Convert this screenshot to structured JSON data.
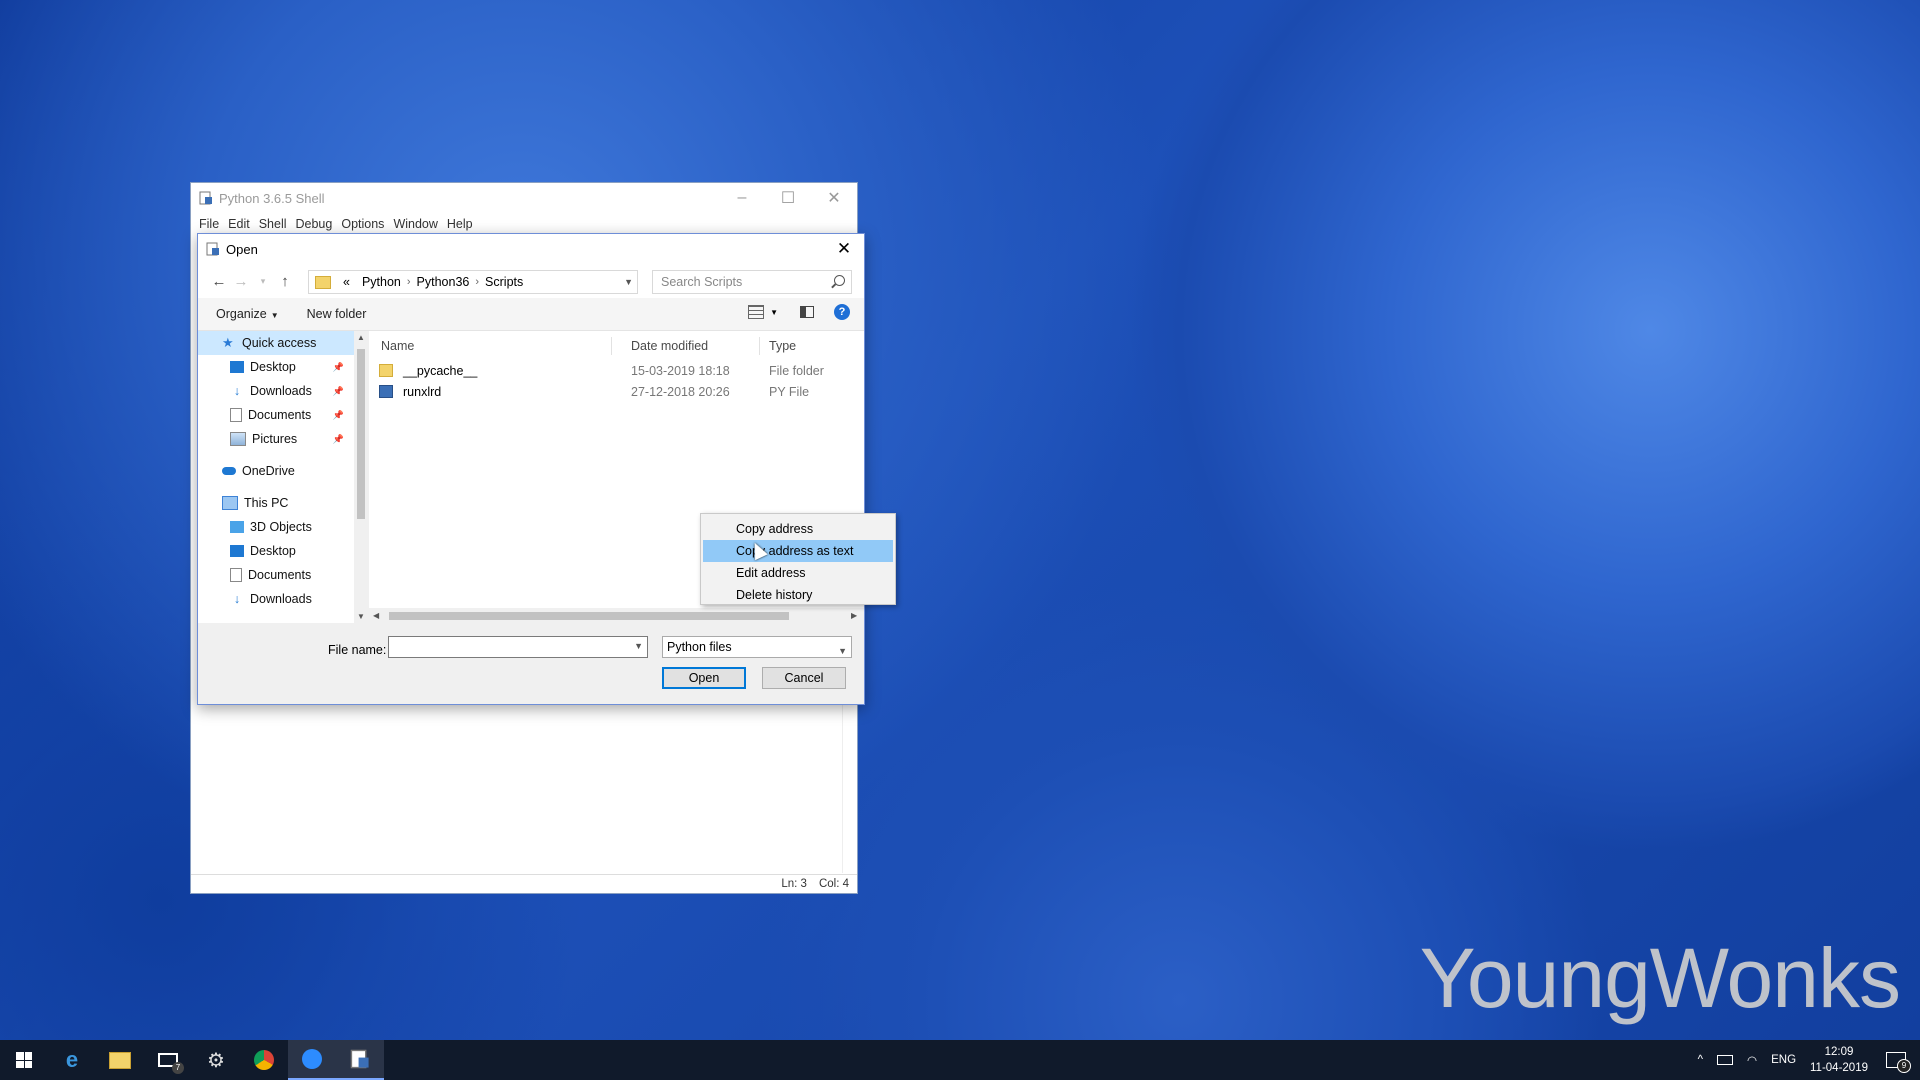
{
  "shell": {
    "title": "Python 3.6.5 Shell",
    "menu": [
      "File",
      "Edit",
      "Shell",
      "Debug",
      "Options",
      "Window",
      "Help"
    ],
    "status_ln": "Ln: 3",
    "status_col": "Col: 4"
  },
  "dialog": {
    "title": "Open",
    "breadcrumb": [
      "«",
      "Python",
      "Python36",
      "Scripts"
    ],
    "search_placeholder": "Search Scripts",
    "toolbar": {
      "organize": "Organize",
      "new_folder": "New folder"
    },
    "nav": [
      {
        "label": "Quick access",
        "icon": "star-icon"
      },
      {
        "label": "Desktop",
        "icon": "desktop-icon",
        "pinned": true
      },
      {
        "label": "Downloads",
        "icon": "download-icon",
        "pinned": true
      },
      {
        "label": "Documents",
        "icon": "document-icon",
        "pinned": true
      },
      {
        "label": "Pictures",
        "icon": "picture-icon",
        "pinned": true
      },
      {
        "label": "OneDrive",
        "icon": "cloud-icon"
      },
      {
        "label": "This PC",
        "icon": "computer-icon"
      },
      {
        "label": "3D Objects",
        "icon": "cube-icon"
      },
      {
        "label": "Desktop",
        "icon": "desktop-icon"
      },
      {
        "label": "Documents",
        "icon": "document-icon"
      },
      {
        "label": "Downloads",
        "icon": "download-icon"
      }
    ],
    "columns": {
      "name": "Name",
      "date": "Date modified",
      "type": "Type"
    },
    "files": [
      {
        "name": "__pycache__",
        "date": "15-03-2019 18:18",
        "type": "File folder"
      },
      {
        "name": "runxlrd",
        "date": "27-12-2018 20:26",
        "type": "PY File"
      }
    ],
    "file_name_label": "File name:",
    "file_name_value": "",
    "file_type": "Python files",
    "open_label": "Open",
    "cancel_label": "Cancel"
  },
  "context_menu": [
    "Copy address",
    "Copy address as text",
    "Edit address",
    "Delete history"
  ],
  "context_menu_highlight": 1,
  "taskbar": {
    "mail_badge": "7",
    "lang": "ENG",
    "time": "12:09",
    "date": "11-04-2019",
    "notifications": "9"
  },
  "watermark": "YoungWonks",
  "colors": {
    "accent": "#0078d7",
    "highlight": "#91c9f7",
    "taskbar": "#101a2b"
  }
}
